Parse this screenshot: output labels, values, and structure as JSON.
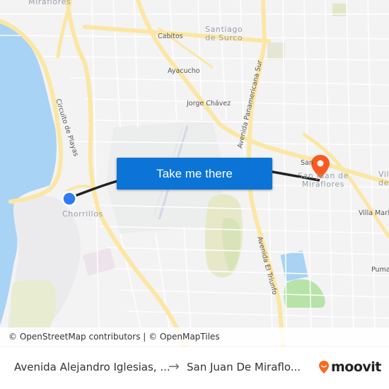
{
  "map": {
    "labels": {
      "miraflores": "Miraflores",
      "cabitos": "Cabitos",
      "santiago_de_surco": "Santiago\nde Surco",
      "ayacucho": "Ayacucho",
      "jorge_chavez": "Jorge Chávez",
      "circuito_de_playas": "Circuito de Playas",
      "panamericana_sur": "Avenida Panamericana Sur",
      "chorrillos": "Chorrillos",
      "san_juan_de_miraflores": "San Juan de\nMiraflores",
      "san": "San",
      "villa_maria": "Villa María",
      "vil": "Vil\ndel",
      "avenida_el_triunfo": "Avenida El Triunfo",
      "pumac": "Pumac"
    },
    "origin_marker": {
      "color": "#2f7cf6"
    },
    "destination_marker": {
      "color": "#fa5a1f"
    },
    "route_color": "#222222",
    "water_color": "#a9d3f5",
    "road_color": "#fbe7a3"
  },
  "cta": {
    "label": "Take me there",
    "color": "#0b74d6"
  },
  "attribution": "© OpenStreetMap contributors | © OpenMapTiles",
  "footer": {
    "from": "Avenida Alejandro Iglesias, ...",
    "arrow": "→",
    "to": "San Juan De Miraflo...",
    "brand": "moovit",
    "brand_color": "#f96b1c"
  }
}
